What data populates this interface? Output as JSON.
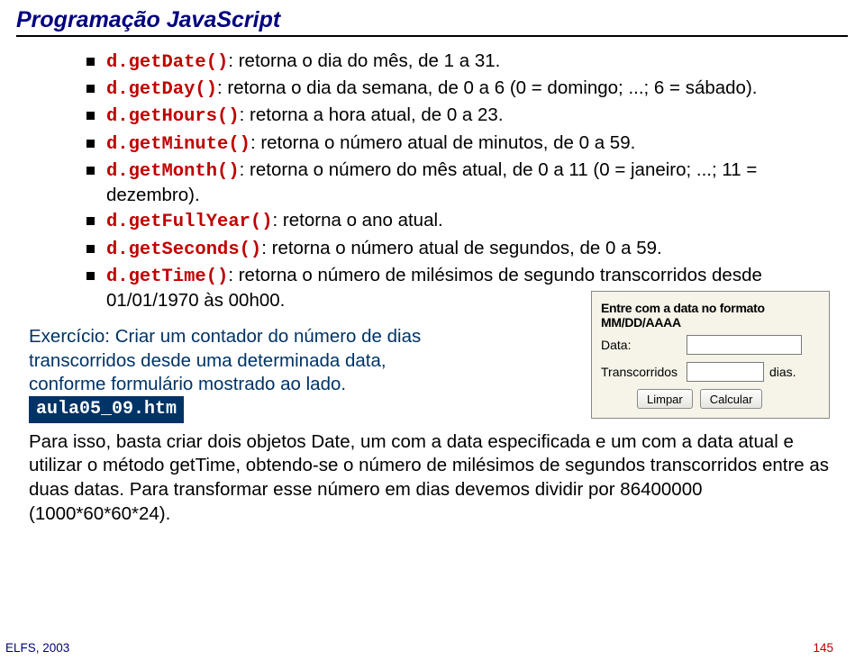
{
  "title": "Programação JavaScript",
  "bullets": [
    {
      "code": "d.getDate()",
      "rest": ": retorna o dia do mês, de 1 a 31."
    },
    {
      "code": "d.getDay()",
      "rest": ": retorna o dia da semana, de 0 a 6 (0 = domingo; ...; 6 = sábado)."
    },
    {
      "code": "d.getHours()",
      "rest": ": retorna a hora atual, de 0 a 23."
    },
    {
      "code": "d.getMinute()",
      "rest": ": retorna o número atual de minutos, de 0 a 59."
    },
    {
      "code": "d.getMonth()",
      "rest": ": retorna o número do mês atual, de 0 a 11 (0 = janeiro; ...; 11 = dezembro)."
    },
    {
      "code": "d.getFullYear()",
      "rest": ": retorna o ano atual."
    },
    {
      "code": "d.getSeconds()",
      "rest": ": retorna o número atual de segundos, de 0 a 59."
    },
    {
      "code": "d.getTime()",
      "rest": ": retorna o número de milésimos de segundo transcorridos desde 01/01/1970 às 00h00."
    }
  ],
  "exercise": {
    "text": "Exercício: Criar um contador do número de dias transcorridos desde uma determinada data, conforme formulário mostrado ao lado.",
    "file": "aula05_09.htm"
  },
  "form": {
    "legend": "Entre com a data no formato MM/DD/AAAA",
    "data_label": "Data:",
    "trans_label": "Transcorridos",
    "dias_suffix": "dias.",
    "btn_clear": "Limpar",
    "btn_calc": "Calcular"
  },
  "paragraph": "Para isso, basta criar dois objetos Date, um com a data especificada e um com a data atual e utilizar o método getTime, obtendo-se o número de milésimos de segundos transcorridos entre as duas datas. Para transformar esse número em dias devemos dividir por 86400000 (1000*60*60*24).",
  "footer": {
    "left": "ELFS, 2003",
    "right": "145"
  }
}
